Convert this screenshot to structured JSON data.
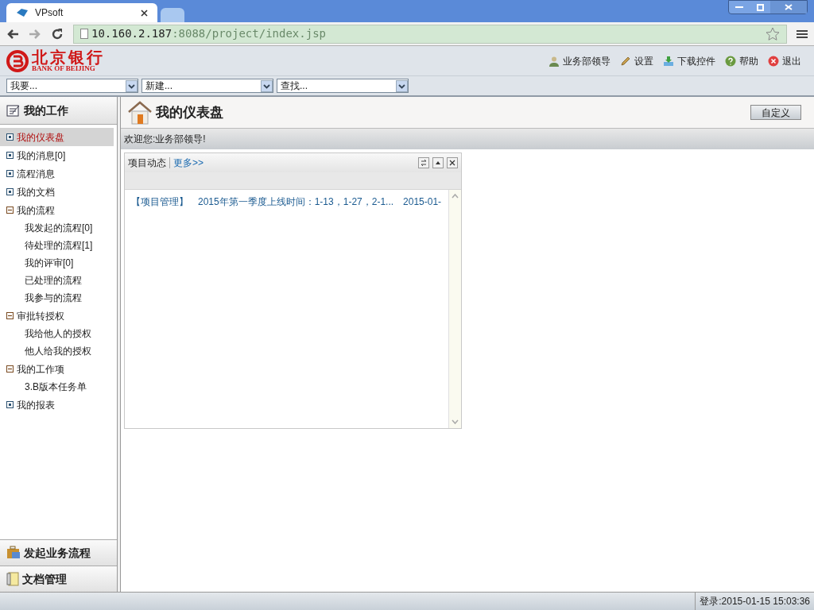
{
  "browser": {
    "tab_title": "VPsoft",
    "url_host": "10.160.2.187",
    "url_rest": ":8088/project/index.jsp"
  },
  "header": {
    "logo_cn": "北京银行",
    "logo_en": "BANK OF BEIJING",
    "links": [
      {
        "kind": "user",
        "label": "业务部领导"
      },
      {
        "kind": "settings",
        "label": "设置"
      },
      {
        "kind": "download",
        "label": "下载控件"
      },
      {
        "kind": "help",
        "label": "帮助"
      },
      {
        "kind": "logout",
        "label": "退出"
      }
    ]
  },
  "selects": [
    {
      "value": "我要..."
    },
    {
      "value": "新建..."
    },
    {
      "value": "查找..."
    }
  ],
  "sidebar": {
    "title": "我的工作",
    "items": [
      {
        "label": "我的仪表盘",
        "selected": true,
        "expanded": false
      },
      {
        "label": "我的消息[0]",
        "selected": false,
        "expanded": false
      },
      {
        "label": "流程消息",
        "selected": false,
        "expanded": false
      },
      {
        "label": "我的文档",
        "selected": false,
        "expanded": false
      },
      {
        "label": "我的流程",
        "selected": false,
        "expanded": true,
        "children": [
          {
            "label": "我发起的流程[0]",
            "selected": false
          },
          {
            "label": "待处理的流程[1]",
            "selected": false
          },
          {
            "label": "我的评审[0]",
            "selected": false
          },
          {
            "label": "已处理的流程",
            "selected": false
          },
          {
            "label": "我参与的流程",
            "selected": false
          }
        ]
      },
      {
        "label": "审批转授权",
        "selected": false,
        "expanded": true,
        "children": [
          {
            "label": "我给他人的授权",
            "selected": false
          },
          {
            "label": "他人给我的授权",
            "selected": false
          }
        ]
      },
      {
        "label": "我的工作项",
        "selected": false,
        "expanded": true,
        "children": [
          {
            "label": "3.B版本任务单",
            "selected": false
          }
        ]
      },
      {
        "label": "我的报表",
        "selected": false,
        "expanded": false
      }
    ],
    "sections": [
      {
        "kind": "process",
        "label": "发起业务流程"
      },
      {
        "kind": "docs",
        "label": "文档管理"
      }
    ]
  },
  "page": {
    "title": "我的仪表盘",
    "customize_button": "自定义",
    "welcome": "欢迎您:业务部领导!"
  },
  "widget": {
    "title": "项目动态",
    "more_link": "更多>>",
    "rows": [
      {
        "category": "【项目管理】",
        "text": "2015年第一季度上线时间：1-13，1-27，2-1...",
        "date": "2015-01-"
      }
    ]
  },
  "status_bar": {
    "login": "登录:2015-01-15 15:03:36"
  }
}
